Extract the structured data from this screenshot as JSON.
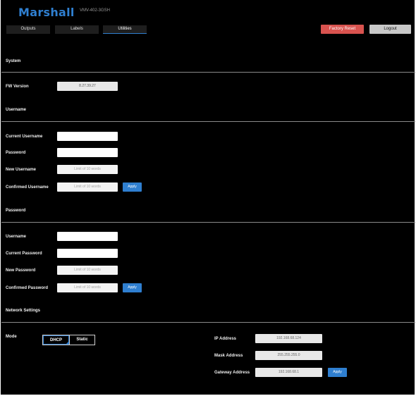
{
  "header": {
    "logo": "Marshall",
    "model": "VMV-402-3GSH"
  },
  "tabs": [
    {
      "label": "Outputs"
    },
    {
      "label": "Labels"
    },
    {
      "label": "Utilities"
    }
  ],
  "actions": {
    "factory_reset": "Factory Reset",
    "logout": "Logout"
  },
  "system": {
    "title": "System",
    "fw_label": "FW Version",
    "fw_value": "8.27.39.27"
  },
  "username_section": {
    "title": "Username",
    "current_username_label": "Current Username",
    "current_username_value": "",
    "password_label": "Password",
    "password_value": "",
    "new_username_label": "New Username",
    "new_username_placeholder": "Limit of 10 words",
    "confirmed_username_label": "Confirmed Username",
    "confirmed_username_placeholder": "Limit of 10 words",
    "apply": "Apply"
  },
  "password_section": {
    "title": "Password",
    "username_label": "Username",
    "username_value": "",
    "current_password_label": "Current Password",
    "current_password_value": "",
    "new_password_label": "New Password",
    "new_password_placeholder": "Limit of 10 words",
    "confirmed_password_label": "Confirmed Password",
    "confirmed_password_placeholder": "Limit of 10 words",
    "apply": "Apply"
  },
  "network": {
    "title": "Network Settings",
    "mode_label": "Mode",
    "mode_options": [
      "DHCP",
      "Static"
    ],
    "mode_selected": "DHCP",
    "ip_label": "IP Address",
    "ip_value": "192.168.68.124",
    "mask_label": "Mask Address",
    "mask_value": "255.255.255.0",
    "gateway_label": "Gateway Address",
    "gateway_value": "192.168.68.1",
    "apply": "Apply"
  },
  "colors": {
    "background": "#000000",
    "accent": "#2f7fd0",
    "danger": "#d9534f",
    "neutral_button": "#c8c8c8"
  }
}
